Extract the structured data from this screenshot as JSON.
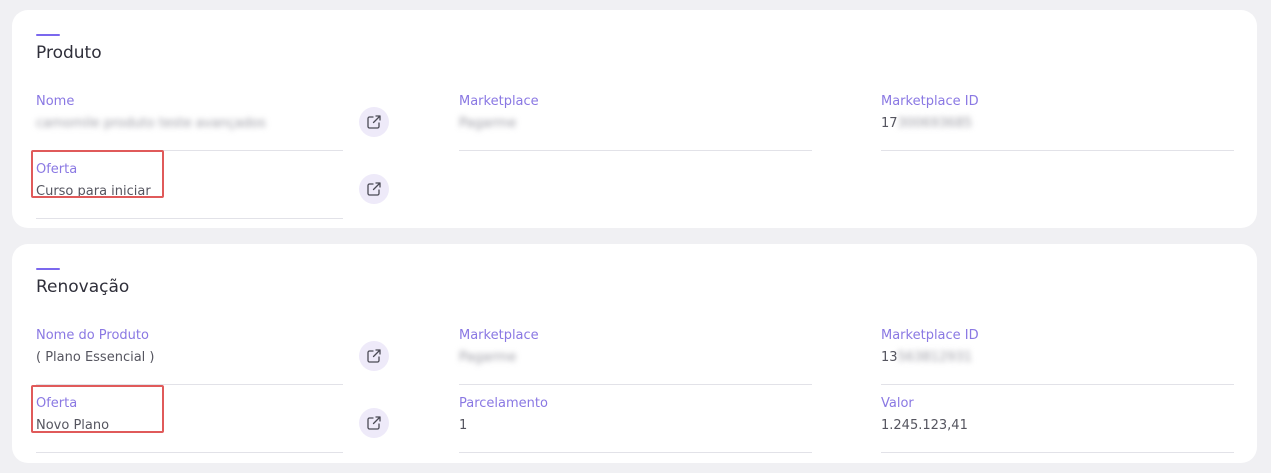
{
  "produto": {
    "title": "Produto",
    "nome": {
      "label": "Nome",
      "value": "camomile produto teste avançados"
    },
    "marketplace": {
      "label": "Marketplace",
      "value": "Pagarme"
    },
    "marketplace_id": {
      "label": "Marketplace ID",
      "visible": "17",
      "hidden": "300693685"
    },
    "oferta": {
      "label": "Oferta",
      "value": "Curso para iniciar"
    }
  },
  "renovacao": {
    "title": "Renovação",
    "nome_produto": {
      "label": "Nome do Produto",
      "value": "( Plano Essencial )"
    },
    "marketplace": {
      "label": "Marketplace",
      "value": "Pagarme"
    },
    "marketplace_id": {
      "label": "Marketplace ID",
      "visible": "13",
      "hidden": "563812931"
    },
    "oferta": {
      "label": "Oferta",
      "value": "Novo Plano"
    },
    "parcelamento": {
      "label": "Parcelamento",
      "value": "1"
    },
    "valor": {
      "label": "Valor",
      "value": "1.245.123,41"
    }
  },
  "colors": {
    "accent": "#7b68ee",
    "label": "#8a78e3",
    "highlight": "#e05a5a",
    "background": "#f0f0f3"
  },
  "icons": {
    "external_link": "external-link-icon"
  }
}
